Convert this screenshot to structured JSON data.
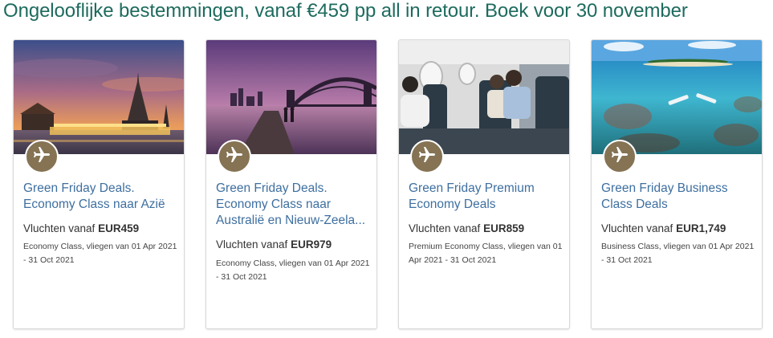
{
  "headline": "Ongelooflijke bestemmingen, vanaf €459 pp all in retour. Boek voor 30 november",
  "colors": {
    "headline": "#1e6b5e",
    "title": "#3e6fa0",
    "badge": "#857354"
  },
  "cards": [
    {
      "image": "bangkok-temple-river-dusk",
      "badge_icon": "airplane-icon",
      "title": "Green Friday Deals. Economy Class naar Azië",
      "price_prefix": "Vluchten vanaf",
      "price": "EUR459",
      "detail": "Economy Class, vliegen van 01 Apr 2021 - 31 Oct 2021"
    },
    {
      "image": "sydney-harbour-bridge-sunset",
      "badge_icon": "airplane-icon",
      "title": "Green Friday Deals. Economy Class naar Australië en Nieuw-Zeela...",
      "price_prefix": "Vluchten vanaf",
      "price": "EUR979",
      "detail": "Economy Class, vliegen van 01 Apr 2021 - 31 Oct 2021"
    },
    {
      "image": "premium-economy-cabin-passengers",
      "badge_icon": "airplane-icon",
      "title": "Green Friday Premium Economy Deals",
      "price_prefix": "Vluchten vanaf",
      "price": "EUR859",
      "detail": "Premium Economy Class, vliegen van 01 Apr 2021 - 31 Oct 2021"
    },
    {
      "image": "tropical-island-reef-snorkeling",
      "badge_icon": "airplane-icon",
      "title": "Green Friday Business Class Deals",
      "price_prefix": "Vluchten vanaf",
      "price": "EUR1,749",
      "detail": "Business Class, vliegen van 01 Apr 2021 - 31 Oct 2021"
    }
  ]
}
